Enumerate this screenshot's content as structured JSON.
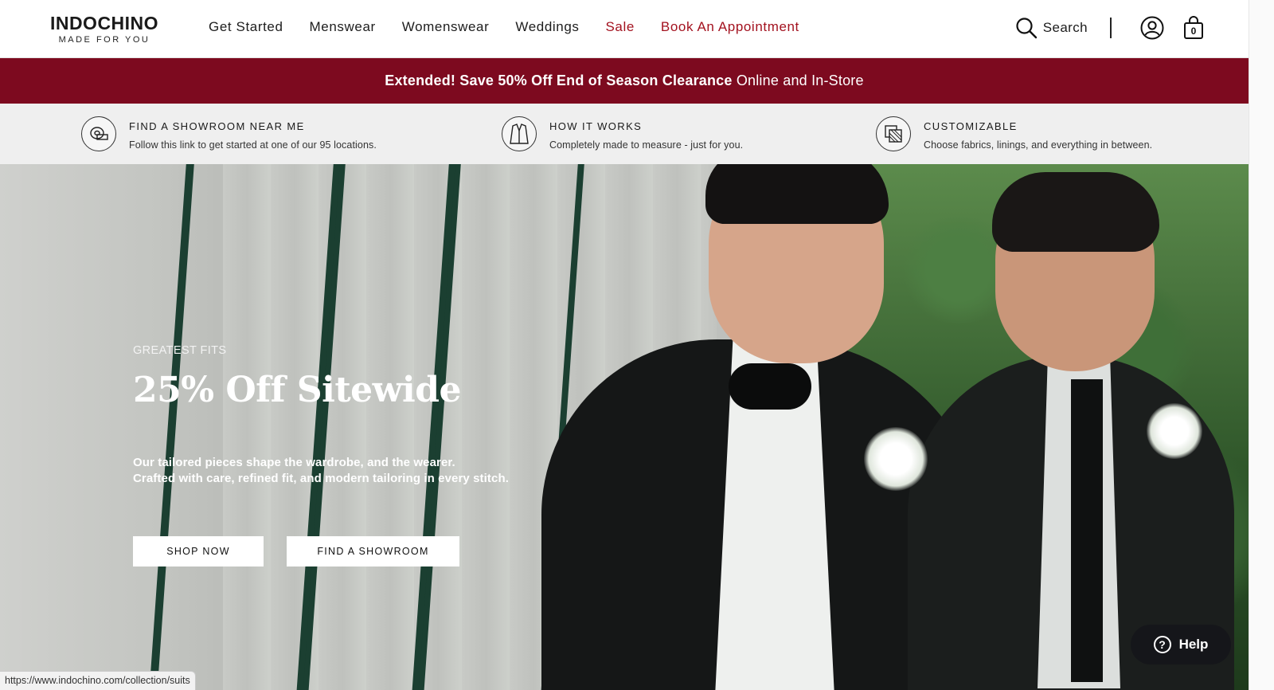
{
  "brand": {
    "name": "INDOCHINO",
    "tagline": "MADE FOR YOU"
  },
  "nav": [
    {
      "label": "Get Started"
    },
    {
      "label": "Menswear"
    },
    {
      "label": "Womenswear"
    },
    {
      "label": "Weddings"
    },
    {
      "label": "Sale"
    },
    {
      "label": "Book An Appointment"
    }
  ],
  "header": {
    "search_label": "Search",
    "cart_count": "0"
  },
  "promo": {
    "bold": "Extended! Save 50% Off End of Season Clearance",
    "rest": "Online and In-Store"
  },
  "features": [
    {
      "title": "FIND A SHOWROOM NEAR ME",
      "desc": "Follow this link to get started at one of our 95 locations.",
      "icon": "measuring-tape-icon"
    },
    {
      "title": "HOW IT WORKS",
      "desc": "Completely made to measure - just for you.",
      "icon": "suit-jacket-icon"
    },
    {
      "title": "CUSTOMIZABLE",
      "desc": "Choose fabrics, linings, and everything in between.",
      "icon": "fabric-swatch-icon"
    }
  ],
  "hero": {
    "eyebrow": "GREATEST FITS",
    "headline": "25% Off Sitewide",
    "sub_line1": "Our tailored pieces shape the wardrobe, and the wearer.",
    "sub_line2": "Crafted with care, refined fit, and modern tailoring in every stitch.",
    "cta_primary": "SHOP NOW",
    "cta_secondary": "FIND A SHOWROOM"
  },
  "status_bar": {
    "url": "https://www.indochino.com/collection/suits"
  },
  "help": {
    "label": "Help"
  },
  "colors": {
    "promo_bg": "#7d0a1f",
    "accent_red": "#a3121f",
    "help_bg": "#15161a"
  }
}
